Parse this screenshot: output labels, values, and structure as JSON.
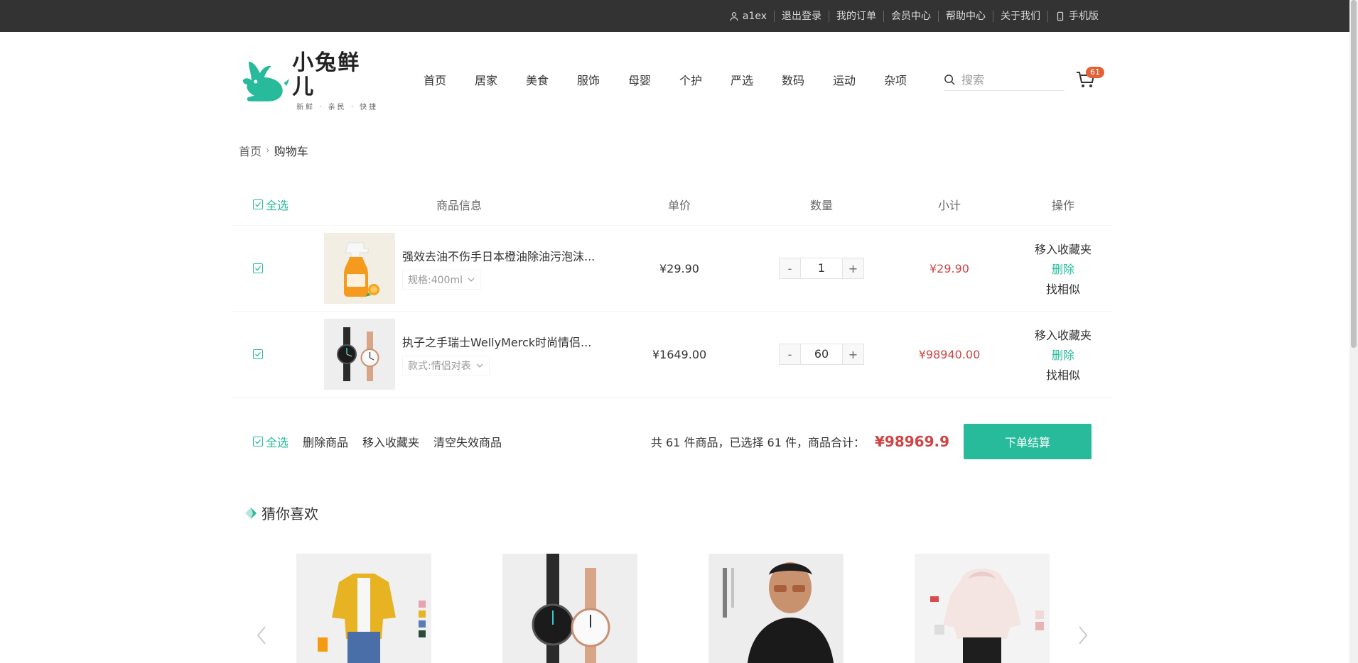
{
  "topbar": {
    "user": "a1ex",
    "links": [
      "退出登录",
      "我的订单",
      "会员中心",
      "帮助中心",
      "关于我们",
      "手机版"
    ]
  },
  "logo": {
    "name": "小兔鲜儿",
    "slogan": "新鲜 · 亲民 · 快捷"
  },
  "nav": [
    "首页",
    "居家",
    "美食",
    "服饰",
    "母婴",
    "个护",
    "严选",
    "数码",
    "运动",
    "杂项"
  ],
  "search": {
    "placeholder": "搜索"
  },
  "cart_badge": "61",
  "breadcrumb": {
    "home": "首页",
    "current": "购物车"
  },
  "table": {
    "headers": {
      "select_all": "全选",
      "info": "商品信息",
      "price": "单价",
      "qty": "数量",
      "subtotal": "小计",
      "action": "操作"
    },
    "rows": [
      {
        "name": "强效去油不伤手日本橙油除油污泡沫...",
        "attr": "规格:400ml",
        "price": "¥29.90",
        "qty": "1",
        "subtotal": "¥29.90",
        "act_fav": "移入收藏夹",
        "act_del": "删除",
        "act_similar": "找相似"
      },
      {
        "name": "执子之手瑞士WellyMerck时尚情侣...",
        "attr": "款式:情侣对表",
        "price": "¥1649.00",
        "qty": "60",
        "subtotal": "¥98940.00",
        "act_fav": "移入收藏夹",
        "act_del": "删除",
        "act_similar": "找相似"
      }
    ],
    "qty_minus": "-",
    "qty_plus": "+"
  },
  "action_bar": {
    "select_all": "全选",
    "delete": "删除商品",
    "move_fav": "移入收藏夹",
    "clear_invalid": "清空失效商品",
    "summary": "共 61 件商品，已选择 61 件，商品合计：",
    "total": "¥98969.9",
    "checkout": "下单结算"
  },
  "guess": {
    "title": "猜你喜欢"
  },
  "colors": {
    "brand": "#27ba9b",
    "price": "#cf4444",
    "topbar": "#333333",
    "badge": "#e26237"
  }
}
